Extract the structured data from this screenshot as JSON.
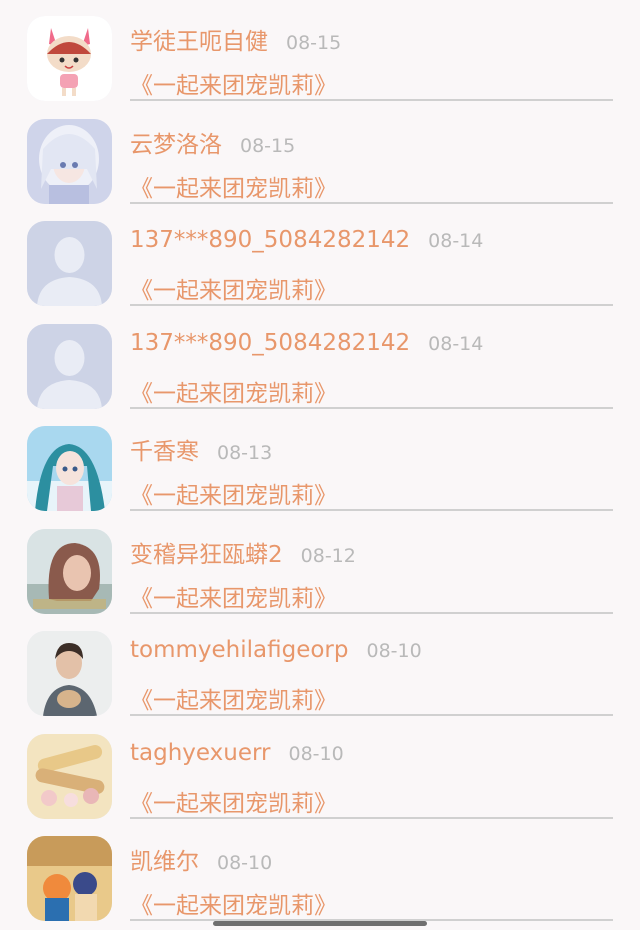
{
  "entries": [
    {
      "name": "学徒王呃自健",
      "date": "08-15",
      "book": "《一起来团宠凯莉》",
      "avatar_icon": "bunny-hat-girl-avatar"
    },
    {
      "name": "云梦洛洛",
      "date": "08-15",
      "book": "《一起来团宠凯莉》",
      "avatar_icon": "anime-girl-lace-avatar"
    },
    {
      "name": "137***890_5084282142",
      "date": "08-14",
      "book": "《一起来团宠凯莉》",
      "avatar_icon": "default-person-avatar"
    },
    {
      "name": "137***890_5084282142",
      "date": "08-14",
      "book": "《一起来团宠凯莉》",
      "avatar_icon": "default-person-avatar"
    },
    {
      "name": "千香寒",
      "date": "08-13",
      "book": "《一起来团宠凯莉》",
      "avatar_icon": "anime-teal-hair-avatar"
    },
    {
      "name": "变稽异狂瓯蟒2",
      "date": "08-12",
      "book": "《一起来团宠凯莉》",
      "avatar_icon": "woman-portrait-avatar"
    },
    {
      "name": "tommyehilafigeorp",
      "date": "08-10",
      "book": "《一起来团宠凯莉》",
      "avatar_icon": "man-with-cat-avatar"
    },
    {
      "name": "taghyexuerr",
      "date": "08-10",
      "book": "《一起来团宠凯莉》",
      "avatar_icon": "food-snacks-avatar"
    },
    {
      "name": "凯维尔",
      "date": "08-10",
      "book": "《一起来团宠凯莉》",
      "avatar_icon": "cartoon-kids-avatar"
    }
  ],
  "colors": {
    "accent": "#e8976b",
    "date": "#b9b9b9",
    "background": "#faf7f8"
  }
}
